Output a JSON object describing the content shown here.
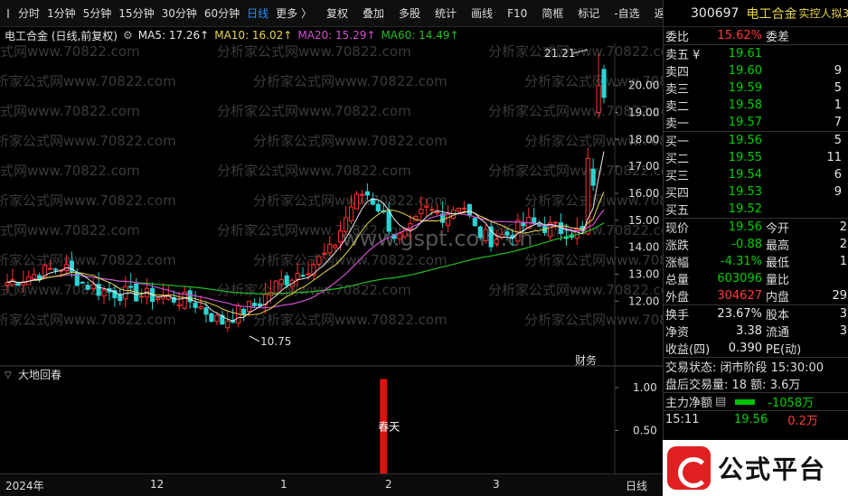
{
  "toolbar": {
    "items": [
      "分时",
      "1分钟",
      "5分钟",
      "15分钟",
      "30分钟",
      "60分钟",
      "日线",
      "更多 〉"
    ],
    "active_index": 6,
    "tools": [
      "复权",
      "叠加",
      "多股",
      "统计",
      "画线",
      "F10",
      "简框",
      "标记",
      "-自选",
      "返回"
    ]
  },
  "legend": {
    "title": "电工合金 (日线,前复权)",
    "ma5": "MA5: 17.26↑",
    "ma10": "MA10: 16.02↑",
    "ma20": "MA20: 15.29↑",
    "ma60": "MA60: 14.49↑"
  },
  "colors": {
    "ma5": "#e8e8e8",
    "ma10": "#e8d44d",
    "ma20": "#d050d0",
    "ma60": "#20c020",
    "up": "#ff3030",
    "down": "#2ad4d4",
    "accent": "#2e8cff"
  },
  "price_axis": [
    "21.21",
    "20.00",
    "19.00",
    "18.00",
    "17.00",
    "16.00",
    "15.00",
    "14.00",
    "13.00",
    "12.00"
  ],
  "annotations": {
    "high": "21.21",
    "low": "10.75",
    "caibao": "财务"
  },
  "watermark": "分析家公式网www.70822.com",
  "watermark_center": "www.gspt.com.cn",
  "indicator": {
    "name": "大地回春",
    "axis": [
      "1.00",
      "0.50"
    ],
    "signal_label": "春天"
  },
  "xaxis": {
    "labels": [
      "2024年",
      "12",
      "1",
      "2",
      "3"
    ],
    "period": "日线"
  },
  "chart_data": {
    "type": "candlestick",
    "title": "电工合金 (日线,前复权)",
    "ylim": [
      10.0,
      21.5
    ],
    "highest": 21.21,
    "lowest": 10.75,
    "ma_latest": {
      "MA5": 17.26,
      "MA10": 16.02,
      "MA20": 15.29,
      "MA60": 14.49
    },
    "months": [
      "2024年",
      "12",
      "1",
      "2",
      "3"
    ],
    "indicator": {
      "name": "大地回春",
      "ylim": [
        0,
        1.2
      ],
      "signal_value": 1.0,
      "signal_label": "春天"
    }
  },
  "quote": {
    "code": "300697",
    "name": "电工合金",
    "tag": "实控人拟3",
    "weibi_label": "委比",
    "weibi": "15.62%",
    "weicha_label": "委差",
    "asks": [
      {
        "label": "卖五 ¥",
        "price": "19.61",
        "vol": ""
      },
      {
        "label": "卖四",
        "price": "19.60",
        "vol": "9"
      },
      {
        "label": "卖三",
        "price": "19.59",
        "vol": "5"
      },
      {
        "label": "卖二",
        "price": "19.58",
        "vol": "1"
      },
      {
        "label": "卖一",
        "price": "19.57",
        "vol": "7"
      }
    ],
    "bids": [
      {
        "label": "买一",
        "price": "19.56",
        "vol": "5"
      },
      {
        "label": "买二",
        "price": "19.55",
        "vol": "11"
      },
      {
        "label": "买三",
        "price": "19.54",
        "vol": "6"
      },
      {
        "label": "买四",
        "price": "19.53",
        "vol": "9"
      },
      {
        "label": "买五",
        "price": "19.52",
        "vol": ""
      }
    ],
    "stats": [
      {
        "l1": "现价",
        "v1": "19.56",
        "c1": "green",
        "l2": "今开",
        "v2": "2"
      },
      {
        "l1": "涨跌",
        "v1": "-0.88",
        "c1": "green",
        "l2": "最高",
        "v2": "2"
      },
      {
        "l1": "涨幅",
        "v1": "-4.31%",
        "c1": "green",
        "l2": "最低",
        "v2": "1"
      },
      {
        "l1": "总量",
        "v1": "603096",
        "c1": "green",
        "l2": "量比",
        "v2": ""
      },
      {
        "l1": "外盘",
        "v1": "304627",
        "c1": "red",
        "l2": "内盘",
        "v2": "29"
      }
    ],
    "stats2": [
      {
        "l1": "换手",
        "v1": "23.67%",
        "l2": "股本",
        "v2": "3"
      },
      {
        "l1": "净资",
        "v1": "3.38",
        "l2": "流通",
        "v2": "3"
      },
      {
        "l1": "收益(四)",
        "v1": "0.390",
        "l2": "PE(动)",
        "v2": ""
      }
    ],
    "trade_status": "交易状态: 闭市阶段 15:30:00",
    "after_hours": "盘后交易量: 18  额: 3.6万",
    "main_net_label": "主力净额",
    "main_net": "-1058万",
    "tick_time": "15:11",
    "tick_price": "19.56",
    "tick_vol": "0.2万"
  },
  "logo_text": "公式平台"
}
